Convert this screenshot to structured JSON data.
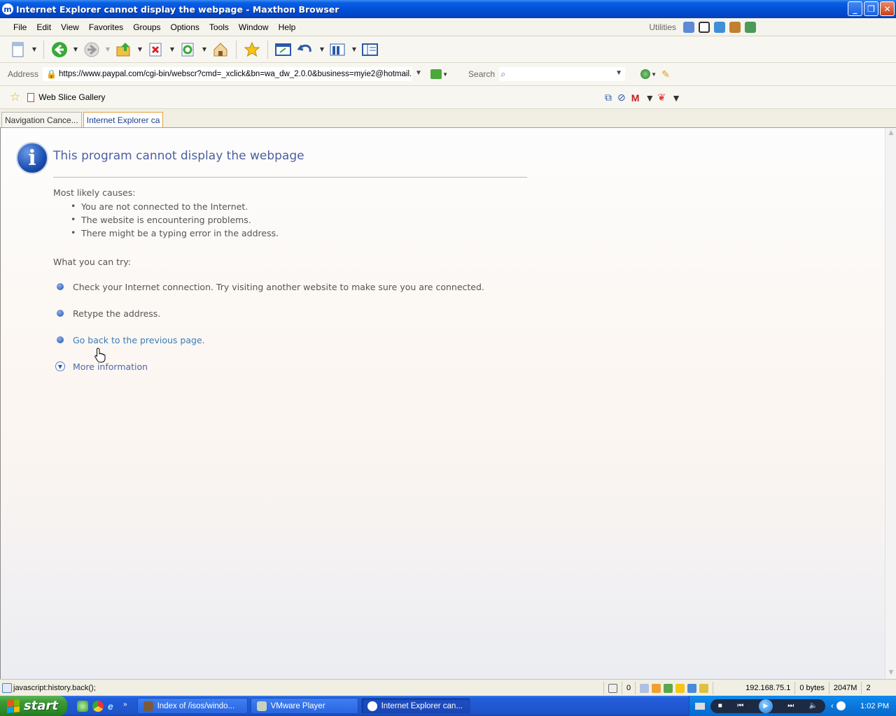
{
  "window": {
    "title": "Internet Explorer cannot display the webpage - Maxthon Browser",
    "app_icon_letter": "m"
  },
  "menubar": {
    "items": [
      {
        "label": "File"
      },
      {
        "label": "Edit"
      },
      {
        "label": "View"
      },
      {
        "label": "Favorites"
      },
      {
        "label": "Groups"
      },
      {
        "label": "Options"
      },
      {
        "label": "Tools"
      },
      {
        "label": "Window"
      },
      {
        "label": "Help"
      }
    ],
    "utilities_label": "Utilities"
  },
  "addressbar": {
    "label": "Address",
    "url": "https://www.paypal.com/cgi-bin/webscr?cmd=_xclick&bn=wa_dw_2.0.0&business=myie2@hotmail.c",
    "search_label": "Search",
    "search_value": ""
  },
  "linksbar": {
    "web_slice_label": "Web Slice Gallery"
  },
  "tabs": [
    {
      "label": "Navigation Cance...",
      "active": false
    },
    {
      "label": "Internet Explorer ca",
      "active": true
    }
  ],
  "page": {
    "title": "This program cannot display the webpage",
    "causes_heading": "Most likely causes:",
    "causes": [
      "You are not connected to the Internet.",
      "The website is encountering problems.",
      "There might be a typing error in the address."
    ],
    "try_heading": "What you can try:",
    "try_items": [
      "Check your Internet connection. Try visiting another website to make sure you are connected.",
      "Retype the address."
    ],
    "back_link": "Go back to the previous page.",
    "more_info_link": "More information"
  },
  "statusbar": {
    "text": "javascript:history.back();",
    "count": "0",
    "ip": "192.168.75.1",
    "bytes": "0 bytes",
    "memory": "2047M",
    "last": "2"
  },
  "taskbar": {
    "start_label": "start",
    "tasks": [
      {
        "label": "Index of /isos/windo...",
        "active": false
      },
      {
        "label": "VMware Player",
        "active": false
      },
      {
        "label": "Internet Explorer can...",
        "active": true
      }
    ],
    "clock": "1:02 PM"
  },
  "colors": {
    "titlebar": "#0251d8",
    "link": "#3a7cb8",
    "page_title": "#4b5fa0",
    "active_tab_border": "#e0a040"
  }
}
